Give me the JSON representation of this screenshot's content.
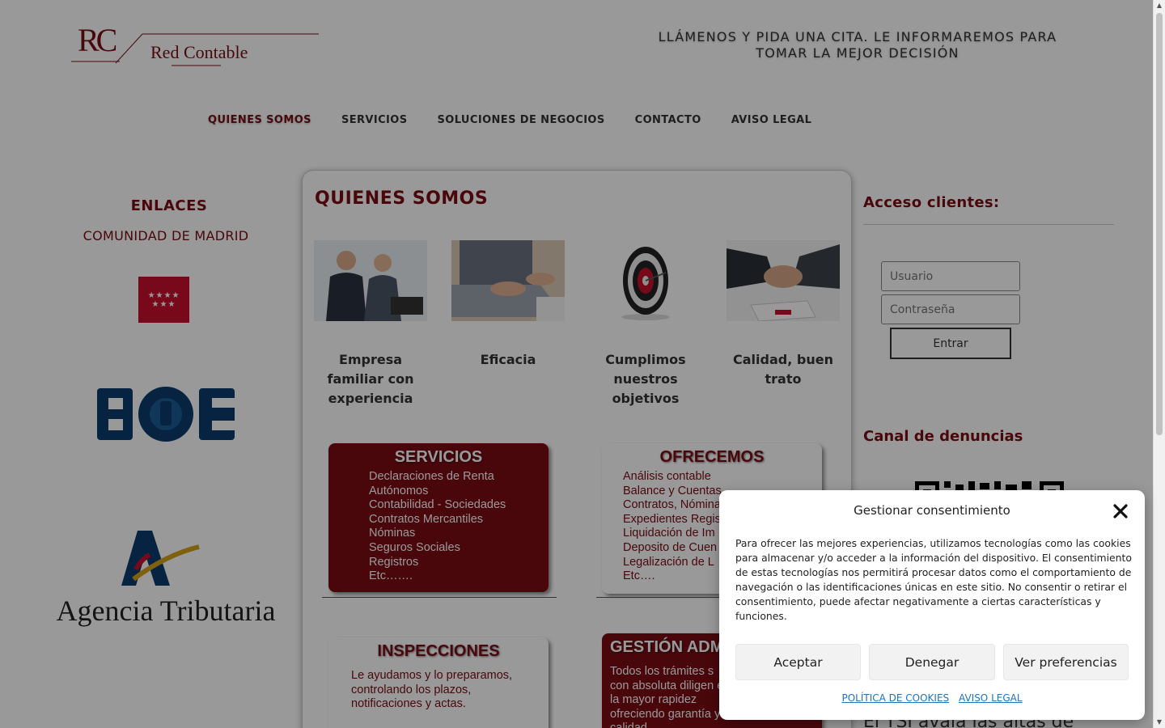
{
  "header": {
    "logo_initials": "RC",
    "logo_name": "Red Contable",
    "tagline": "LLÁMENOS Y PIDA UNA CITA. LE INFORMAREMOS PARA TOMAR LA MEJOR DECISIÓN"
  },
  "nav": {
    "items": [
      {
        "label": "QUIENES SOMOS",
        "active": true
      },
      {
        "label": "SERVICIOS"
      },
      {
        "label": "SOLUCIONES DE NEGOCIOS"
      },
      {
        "label": "CONTACTO"
      },
      {
        "label": "AVISO LEGAL"
      }
    ]
  },
  "left": {
    "heading": "ENLACES",
    "link": "COMUNIDAD DE MADRID",
    "aeat_text": "Agencia Tributaria",
    "boe_text": "BOE"
  },
  "main": {
    "title": "QUIENES SOMOS",
    "features": [
      {
        "caption": "Empresa familiar con experiencia",
        "image": "business-people-photo"
      },
      {
        "caption": "Eficacia",
        "image": "laptop-hands-photo"
      },
      {
        "caption": "Cumplimos nuestros objetivos",
        "image": "dartboard-photo"
      },
      {
        "caption": "Calidad, buen trato",
        "image": "handshake-photo"
      }
    ],
    "cards": {
      "servicios": {
        "title": "SERVICIOS",
        "items": [
          "Declaraciones de Renta",
          "Autónomos",
          "Contabilidad - Sociedades",
          "Contratos Mercantiles",
          "Nóminas",
          "Seguros Sociales",
          "Registros",
          "Etc……."
        ]
      },
      "ofrecemos": {
        "title": "OFRECEMOS",
        "items": [
          "Análisis  contable",
          "Balance y Cuentas",
          "Contratos, Nóminas",
          "Expedientes Regis",
          "Liquidación de Im",
          "Deposito de Cuen",
          "Legalización de L",
          "Etc…."
        ]
      },
      "inspecciones": {
        "title": "INSPECCIONES",
        "text": "Le ayudamos y lo preparamos, controlando los plazos, notificaciones y actas."
      },
      "gestion": {
        "title": "GESTIÓN ADM",
        "text": "Todos los trámites s con absoluta diligen en la mayor rapidez ofreciendo garantía y calidad"
      }
    }
  },
  "right": {
    "login_heading": "Acceso clientes:",
    "username_placeholder": "Usuario",
    "password_placeholder": "Contraseña",
    "login_button": "Entrar",
    "whistle_heading": "Canal de denuncias",
    "tsi_text": "El TSI avala las altas de"
  },
  "consent": {
    "title": "Gestionar consentimiento",
    "body": "Para ofrecer las mejores experiencias, utilizamos tecnologías como las cookies para almacenar y/o acceder a la información del dispositivo. El consentimiento de estas tecnologías nos permitirá procesar datos como el comportamiento de navegación o las identificaciones únicas en este sitio. No consentir o retirar el consentimiento, puede afectar negativamente a ciertas características y funciones.",
    "accept": "Aceptar",
    "deny": "Denegar",
    "preferences": "Ver preferencias",
    "cookie_policy": "POLÍTICA DE COOKIES",
    "legal_notice": "AVISO LEGAL"
  },
  "colors": {
    "brand": "#7a0c14",
    "link": "#1e73be"
  }
}
